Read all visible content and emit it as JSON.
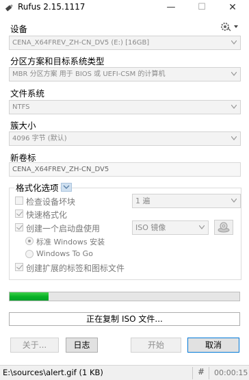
{
  "window": {
    "title": "Rufus 2.15.1117",
    "minimize_glyph": "—",
    "maximize_glyph": "☐",
    "close_glyph": "✕"
  },
  "device": {
    "label": "设备",
    "value": "CENA_X64FREV_ZH-CN_DV5 (E:) [16GB]"
  },
  "partition": {
    "label": "分区方案和目标系统类型",
    "value": "MBR 分区方案 用于 BIOS 或 UEFI-CSM 的计算机"
  },
  "filesystem": {
    "label": "文件系统",
    "value": "NTFS"
  },
  "cluster": {
    "label": "簇大小",
    "value": "4096 字节 (默认)"
  },
  "volume": {
    "label": "新卷标",
    "value": "CENA_X64FREV_ZH-CN_DV5"
  },
  "format_options": {
    "title": "格式化选项",
    "check_bad_blocks": {
      "label": "检查设备坏块",
      "checked": false,
      "passes": "1 遍"
    },
    "quick_format": {
      "label": "快速格式化",
      "checked": true
    },
    "bootable": {
      "label": "创建一个启动盘使用",
      "checked": true,
      "image_type": "ISO 镜像"
    },
    "standard_windows": {
      "label": "标准 Windows 安装",
      "selected": true
    },
    "windows_to_go": {
      "label": "Windows To Go",
      "selected": false
    },
    "extended_label": {
      "label": "创建扩展的标签和图标文件",
      "checked": true
    }
  },
  "progress": {
    "percent": 17,
    "color": "#06b025"
  },
  "status_text": "正在复制 ISO 文件...",
  "buttons": {
    "about": "关于...",
    "log": "日志",
    "start": "开始",
    "cancel": "取消"
  },
  "statusbar": {
    "file": "E:\\sources\\alert.gif (1 KB)",
    "hash_symbol": "#",
    "elapsed": "00:00:15"
  },
  "icons": {
    "app": "usb-drive-icon",
    "settings": "settings-gear-icon",
    "disk": "disk-image-icon"
  }
}
